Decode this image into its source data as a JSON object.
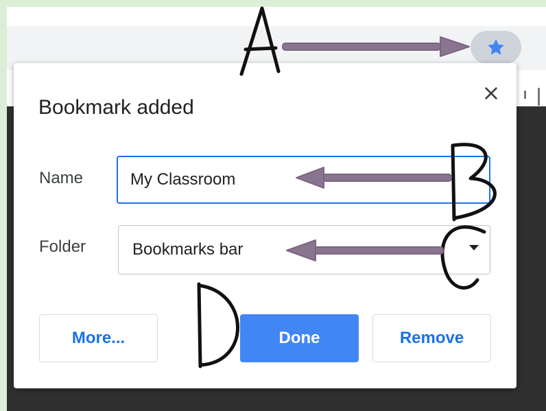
{
  "dialog": {
    "title": "Bookmark added",
    "name_label": "Name",
    "name_value": "My Classroom",
    "folder_label": "Folder",
    "folder_value": "Bookmarks bar",
    "more_label": "More...",
    "done_label": "Done",
    "remove_label": "Remove"
  },
  "annotations": {
    "a": "A",
    "b": "B",
    "c": "C",
    "d": "D"
  },
  "icons": {
    "bookmark": "star-icon",
    "close": "close-icon",
    "dropdown": "caret-down-icon"
  },
  "colors": {
    "accent": "#1a73e8",
    "done_button": "#4286f4",
    "star": "#4285f4",
    "arrow": "#8a7590",
    "background": "#dcefd6"
  }
}
